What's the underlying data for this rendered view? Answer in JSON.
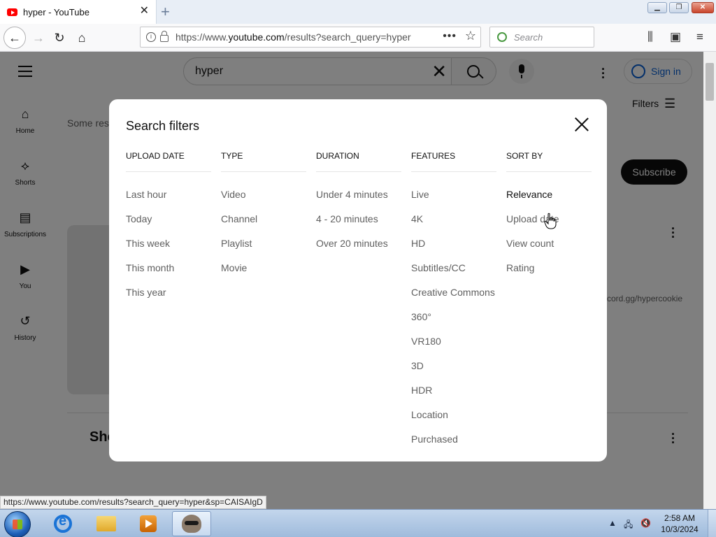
{
  "browser": {
    "tab_title": "hyper - YouTube",
    "url_prefix": "https://www.",
    "url_domain": "youtube.com",
    "url_rest": "/results?search_query=hyper",
    "search_placeholder": "Search",
    "status_url": "https://www.youtube.com/results?search_query=hyper&sp=CAISAIgD"
  },
  "youtube": {
    "search_value": "hyper",
    "sign_in": "Sign in",
    "filters_label": "Filters",
    "subscribe": "Subscribe",
    "partial_text": "Some res",
    "discord_text": "cord.gg/hypercookie",
    "shorts_partial": "Sho",
    "sidebar": [
      {
        "label": "Home",
        "icon": "home-icon"
      },
      {
        "label": "Shorts",
        "icon": "shorts-icon"
      },
      {
        "label": "Subscriptions",
        "icon": "subscriptions-icon"
      },
      {
        "label": "You",
        "icon": "you-icon"
      },
      {
        "label": "History",
        "icon": "history-icon"
      }
    ]
  },
  "modal": {
    "title": "Search filters",
    "columns": [
      {
        "header": "UPLOAD DATE",
        "options": [
          "Last hour",
          "Today",
          "This week",
          "This month",
          "This year"
        ]
      },
      {
        "header": "TYPE",
        "options": [
          "Video",
          "Channel",
          "Playlist",
          "Movie"
        ]
      },
      {
        "header": "DURATION",
        "options": [
          "Under 4 minutes",
          "4 - 20 minutes",
          "Over 20 minutes"
        ]
      },
      {
        "header": "FEATURES",
        "options": [
          "Live",
          "4K",
          "HD",
          "Subtitles/CC",
          "Creative Commons",
          "360°",
          "VR180",
          "3D",
          "HDR",
          "Location",
          "Purchased"
        ]
      },
      {
        "header": "SORT BY",
        "options": [
          "Relevance",
          "Upload date",
          "View count",
          "Rating"
        ],
        "selected": "Relevance"
      }
    ]
  },
  "taskbar": {
    "time": "2:58 AM",
    "date": "10/3/2024"
  }
}
